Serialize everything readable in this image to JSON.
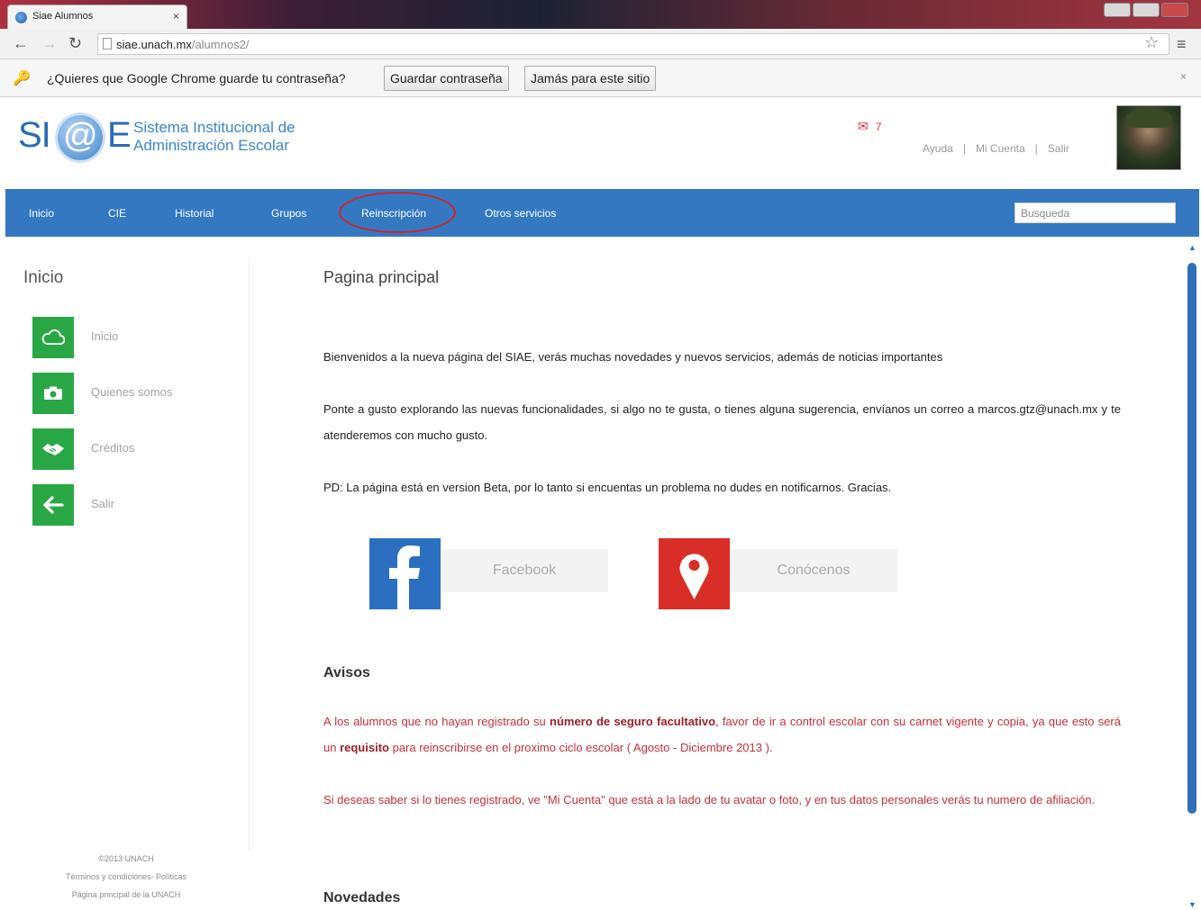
{
  "browser": {
    "tab_title": "Siae Alumnos",
    "tab_close": "×",
    "url_host": "siae.unach.mx",
    "url_path": "/alumnos2/",
    "infobar": {
      "message": "¿Quieres que Google Chrome guarde tu contraseña?",
      "save_button": "Guardar contraseña",
      "never_button": "Jamás para este sitio",
      "close": "×"
    }
  },
  "header": {
    "logo_si": "SI",
    "logo_at": "@",
    "logo_e": "E",
    "site_name_line1": "Sistema Institucional de",
    "site_name_line2": "Administración Escolar",
    "mail_icon": "✉",
    "mail_count": "7",
    "links": [
      "Ayuda",
      "Mi Cuenta",
      "Salir"
    ],
    "separator": "|"
  },
  "nav": {
    "items": [
      "Inicio",
      "CIE",
      "Historial",
      "Grupos",
      "Reinscripción",
      "Otros servicios"
    ],
    "search_placeholder": "Busqueda",
    "highlight_color": "#d2232a",
    "bar_color": "#3478c2"
  },
  "sidebar": {
    "title": "Inicio",
    "items": [
      {
        "label": "Inicio",
        "icon": "cloud-icon"
      },
      {
        "label": "Quienes somos",
        "icon": "camera-icon"
      },
      {
        "label": "Créditos",
        "icon": "handshake-icon"
      },
      {
        "label": "Salir",
        "icon": "arrow-left-icon"
      }
    ],
    "tile_color": "#2aa745",
    "footer": {
      "copyright": "©2013 UNACH",
      "terms": "Términos y condiciones- Políticas",
      "home": "Página principal de la UNACH"
    }
  },
  "main": {
    "title": "Pagina principal",
    "p1": "Bienvenidos a la nueva página del SIAE, verás muchas novedades y nuevos servicios, además de noticias importantes",
    "p2": "Ponte a gusto explorando las nuevas funcionalidades, si algo no te gusta, o tienes alguna sugerencia, envíanos un correo a marcos.gtz@unach.mx y te atenderemos con mucho gusto.",
    "p3": "PD: La página está en version Beta, por lo tanto si encuentas un problema no dudes en notificarnos. Gracias.",
    "social": [
      {
        "label": "Facebook",
        "icon": "facebook-icon",
        "color": "#2c6fc0"
      },
      {
        "label": "Conócenos",
        "icon": "map-pin-icon",
        "color": "#d92e27"
      }
    ],
    "avisos_title": "Avisos",
    "aviso1_a": "A los alumnos que no hayan registrado su ",
    "aviso1_b": "número de seguro facultativo",
    "aviso1_c": ", favor de ir a control escolar con su carnet vigente y copia, ya que esto será un ",
    "aviso1_d": "requisito",
    "aviso1_e": " para reinscribirse en el proximo ciclo escolar ( Agosto - Diciembre 2013 ).",
    "aviso2": "Si deseas saber si lo tienes registrado, ve \"Mi Cuenta\" que está a la lado de tu avatar o foto, y en tus datos personales verás tu numero de afiliación.",
    "novedades_title": "Novedades"
  }
}
